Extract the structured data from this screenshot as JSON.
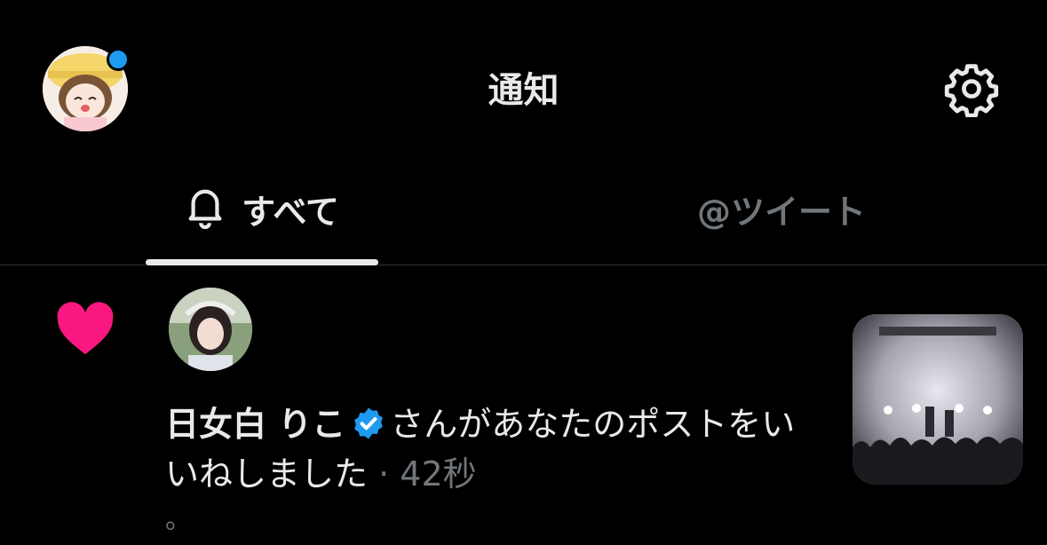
{
  "header": {
    "title": "通知"
  },
  "tabs": [
    {
      "label": "すべて",
      "active": true
    },
    {
      "label": "@ツイート",
      "active": false
    }
  ],
  "notification": {
    "user_name": "日女白 りこ",
    "action_text": "さんがあなたのポストをいいねしました",
    "separator": "·",
    "time": "42秒",
    "trailing": "。"
  },
  "colors": {
    "accent": "#1d9bf0",
    "like": "#f91880",
    "muted": "#71767b"
  }
}
